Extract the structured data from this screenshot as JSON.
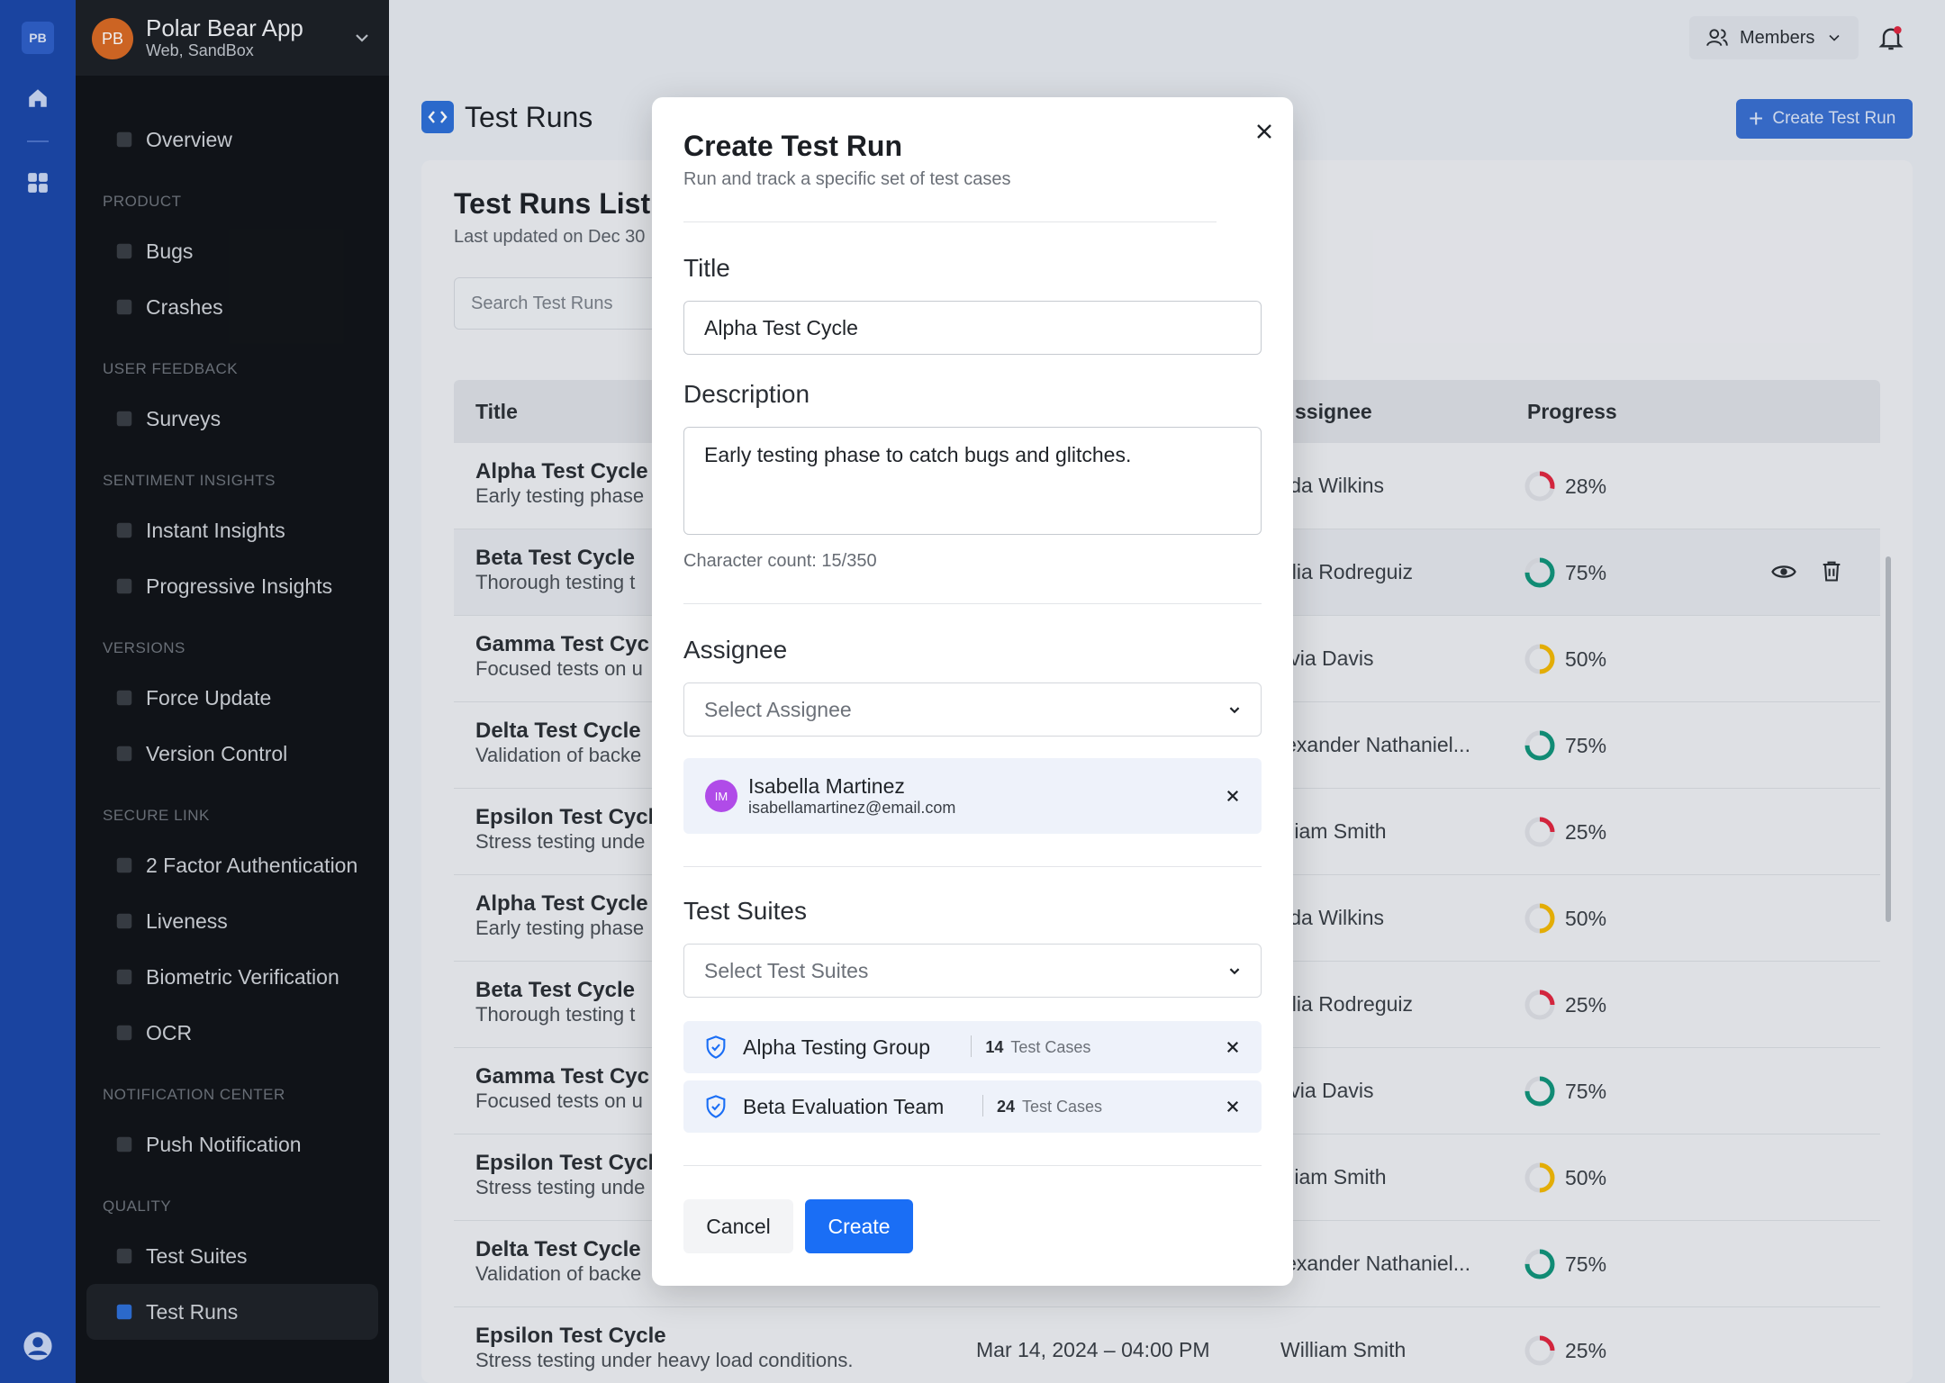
{
  "rail": {
    "logo": "PB",
    "icons": [
      "home-icon",
      "grid-icon",
      "user-icon"
    ]
  },
  "app": {
    "avatar": "PB",
    "name": "Polar Bear App",
    "subtitle": "Web, SandBox"
  },
  "nav": {
    "overview": "Overview",
    "sections": [
      {
        "title": "PRODUCT",
        "items": [
          "Bugs",
          "Crashes"
        ]
      },
      {
        "title": "USER FEEDBACK",
        "items": [
          "Surveys"
        ]
      },
      {
        "title": "SENTIMENT INSIGHTS",
        "items": [
          "Instant Insights",
          "Progressive Insights"
        ]
      },
      {
        "title": "VERSIONS",
        "items": [
          "Force Update",
          "Version Control"
        ]
      },
      {
        "title": "SECURE LINK",
        "items": [
          "2 Factor Authentication",
          "Liveness",
          "Biometric Verification",
          "OCR"
        ]
      },
      {
        "title": "NOTIFICATION CENTER",
        "items": [
          "Push Notification"
        ]
      },
      {
        "title": "QUALITY",
        "items": [
          "Test Suites",
          "Test Runs"
        ]
      }
    ],
    "active": "Test Runs"
  },
  "topbar": {
    "members": "Members"
  },
  "page": {
    "title": "Test Runs",
    "create_button": "Create Test Run"
  },
  "list": {
    "title": "Test Runs List",
    "updated": "Last updated on Dec 30",
    "search_placeholder": "Search Test Runs",
    "columns": {
      "title": "Title",
      "assignee": "ssignee",
      "progress": "Progress"
    },
    "rows": [
      {
        "title": "Alpha Test Cycle",
        "desc": "Early testing phase",
        "date": "",
        "assignee": "ilda Wilkins",
        "progress": "28%",
        "pct": 0.28,
        "color": "#e0273f"
      },
      {
        "title": "Beta Test Cycle",
        "desc": "Thorough testing t",
        "date": "",
        "assignee": "ulia Rodreguiz",
        "progress": "75%",
        "pct": 0.75,
        "color": "#12937a"
      },
      {
        "title": "Gamma Test Cyc",
        "desc": "Focused tests on u",
        "date": "",
        "assignee": "livia Davis",
        "progress": "50%",
        "pct": 0.5,
        "color": "#f2b705"
      },
      {
        "title": "Delta Test Cycle",
        "desc": "Validation of backe",
        "date": "",
        "assignee": "lexander Nathaniel...",
        "progress": "75%",
        "pct": 0.75,
        "color": "#12937a"
      },
      {
        "title": "Epsilon Test Cycl",
        "desc": "Stress testing unde",
        "date": "",
        "assignee": "illiam Smith",
        "progress": "25%",
        "pct": 0.25,
        "color": "#e0273f"
      },
      {
        "title": "Alpha Test Cycle",
        "desc": "Early testing phase",
        "date": "",
        "assignee": "ilda Wilkins",
        "progress": "50%",
        "pct": 0.5,
        "color": "#f2b705"
      },
      {
        "title": "Beta Test Cycle",
        "desc": "Thorough testing t",
        "date": "",
        "assignee": "ulia Rodreguiz",
        "progress": "25%",
        "pct": 0.25,
        "color": "#e0273f"
      },
      {
        "title": "Gamma Test Cyc",
        "desc": "Focused tests on u",
        "date": "",
        "assignee": "livia Davis",
        "progress": "75%",
        "pct": 0.75,
        "color": "#12937a"
      },
      {
        "title": "Epsilon Test Cycl",
        "desc": "Stress testing unde",
        "date": "",
        "assignee": "illiam Smith",
        "progress": "50%",
        "pct": 0.5,
        "color": "#f2b705"
      },
      {
        "title": "Delta Test Cycle",
        "desc": "Validation of backe",
        "date": "",
        "assignee": "lexander Nathaniel...",
        "progress": "75%",
        "pct": 0.75,
        "color": "#12937a"
      },
      {
        "title": "Epsilon Test Cycle",
        "desc": "Stress testing under heavy load conditions.",
        "date": "Mar 14, 2024 – 04:00 PM",
        "assignee": "William Smith",
        "progress": "25%",
        "pct": 0.25,
        "color": "#e0273f"
      }
    ]
  },
  "modal": {
    "title": "Create Test Run",
    "subtitle": "Run and track a specific set of test cases",
    "title_label": "Title",
    "title_value": "Alpha Test Cycle",
    "description_label": "Description",
    "description_value": "Early testing phase to catch bugs and glitches.",
    "char_count": "Character count: 15/350",
    "assignee_label": "Assignee",
    "assignee_placeholder": "Select Assignee",
    "assignee": {
      "initials": "IM",
      "name": "Isabella Martinez",
      "email": "isabellamartinez@email.com"
    },
    "suites_label": "Test Suites",
    "suites_placeholder": "Select Test Suites",
    "suites": [
      {
        "name": "Alpha Testing Group",
        "count": "14",
        "unit": "Test Cases"
      },
      {
        "name": "Beta Evaluation Team",
        "count": "24",
        "unit": "Test Cases"
      }
    ],
    "cancel": "Cancel",
    "create": "Create"
  },
  "colors": {
    "primary": "#1a6ef5",
    "rail": "#1c48a8",
    "sidebar": "#121418",
    "danger": "#e0273f",
    "success": "#12937a",
    "warning": "#f2b705"
  }
}
